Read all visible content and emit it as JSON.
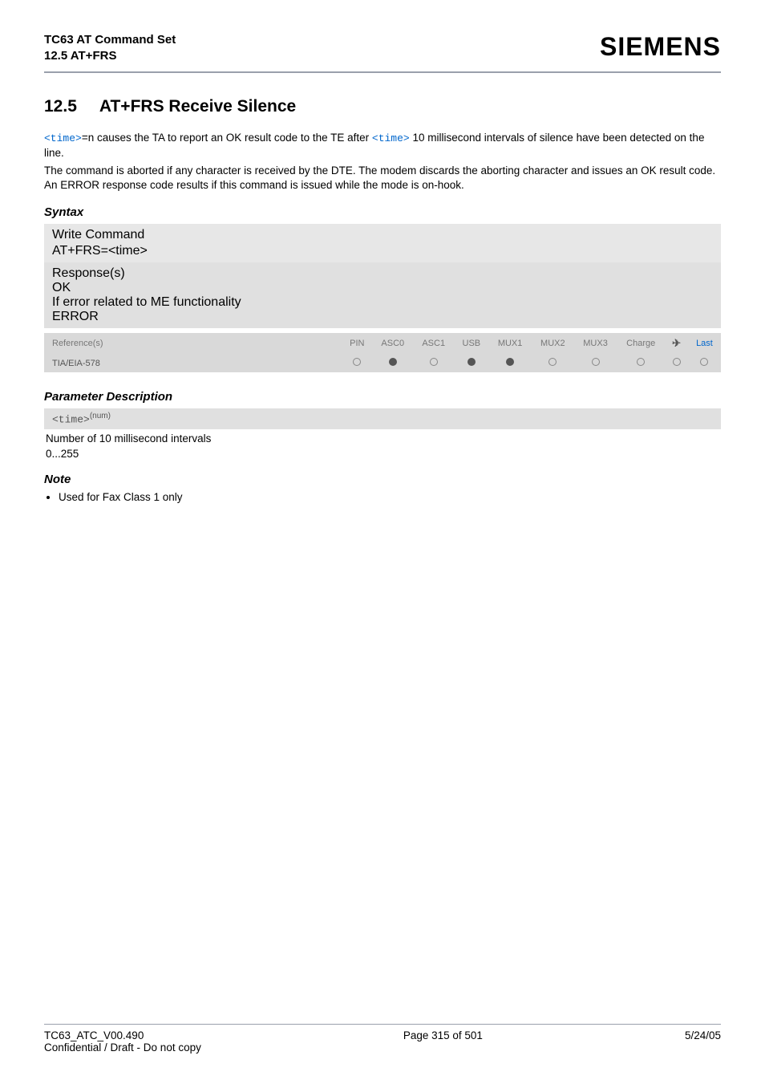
{
  "header": {
    "product_line": "TC63 AT Command Set",
    "section_line": "12.5 AT+FRS",
    "brand": "SIEMENS"
  },
  "title": {
    "number": "12.5",
    "text": "AT+FRS   Receive Silence"
  },
  "intro": {
    "code1": "<time>",
    "frag1": "=n causes the TA to report an OK result code to the TE after ",
    "code2": "<time>",
    "frag2": " 10 millisecond intervals of silence have been detected on the line.",
    "para2": "The command is aborted if any character is received by the DTE. The modem discards the aborting character and issues an OK result code. An ERROR response code results if this command is issued while the mode is on-hook."
  },
  "syntax": {
    "heading": "Syntax",
    "write_label": "Write Command",
    "write_cmd_prefix": "AT+FRS=",
    "write_cmd_param": "<time>",
    "responses_label": "Response(s)",
    "resp_line1": "OK",
    "resp_line2": "If error related to ME functionality",
    "resp_line3": "ERROR"
  },
  "ref_table": {
    "ref_label": "Reference(s)",
    "cols": [
      "PIN",
      "ASC0",
      "ASC1",
      "USB",
      "MUX1",
      "MUX2",
      "MUX3",
      "Charge",
      "✈",
      "Last"
    ],
    "row_name": "TIA/EIA-578",
    "row_vals": [
      "empty",
      "filled",
      "empty",
      "filled",
      "filled",
      "empty",
      "empty",
      "empty",
      "empty",
      "empty"
    ]
  },
  "param": {
    "heading": "Parameter Description",
    "token": "<time>",
    "sup": "(num)",
    "desc": "Number of 10 millisecond intervals",
    "range": "0...255"
  },
  "note": {
    "heading": "Note",
    "item": "Used for Fax Class 1 only"
  },
  "footer": {
    "left1": "TC63_ATC_V00.490",
    "left2": "Confidential / Draft - Do not copy",
    "center": "Page 315 of 501",
    "right": "5/24/05"
  }
}
